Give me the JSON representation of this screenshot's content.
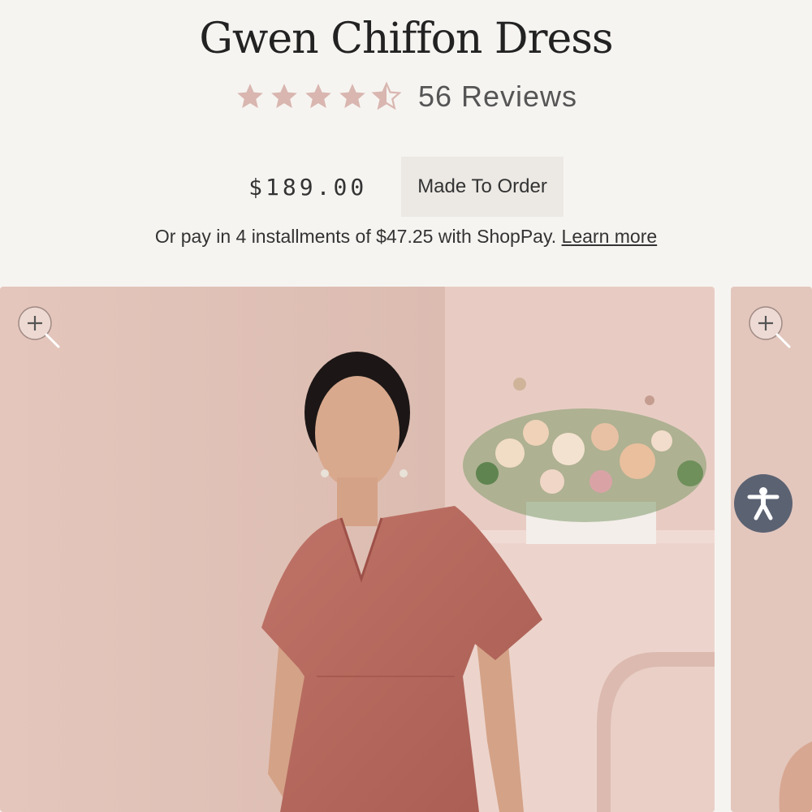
{
  "product": {
    "title": "Gwen Chiffon Dress",
    "rating": 4.5,
    "reviews_label": "56 Reviews",
    "price": "$189.00",
    "badge": "Made To Order",
    "installments_text": "Or pay in 4 installments of $47.25 with ShopPay.",
    "learn_more": "Learn more"
  },
  "colors": {
    "star": "#d9b6b0",
    "dress": "#b8685e",
    "wall": "#e2c4ba",
    "a11y_button": "#5b6272"
  },
  "icons": {
    "zoom": "zoom-in-icon",
    "accessibility": "accessibility-icon"
  }
}
